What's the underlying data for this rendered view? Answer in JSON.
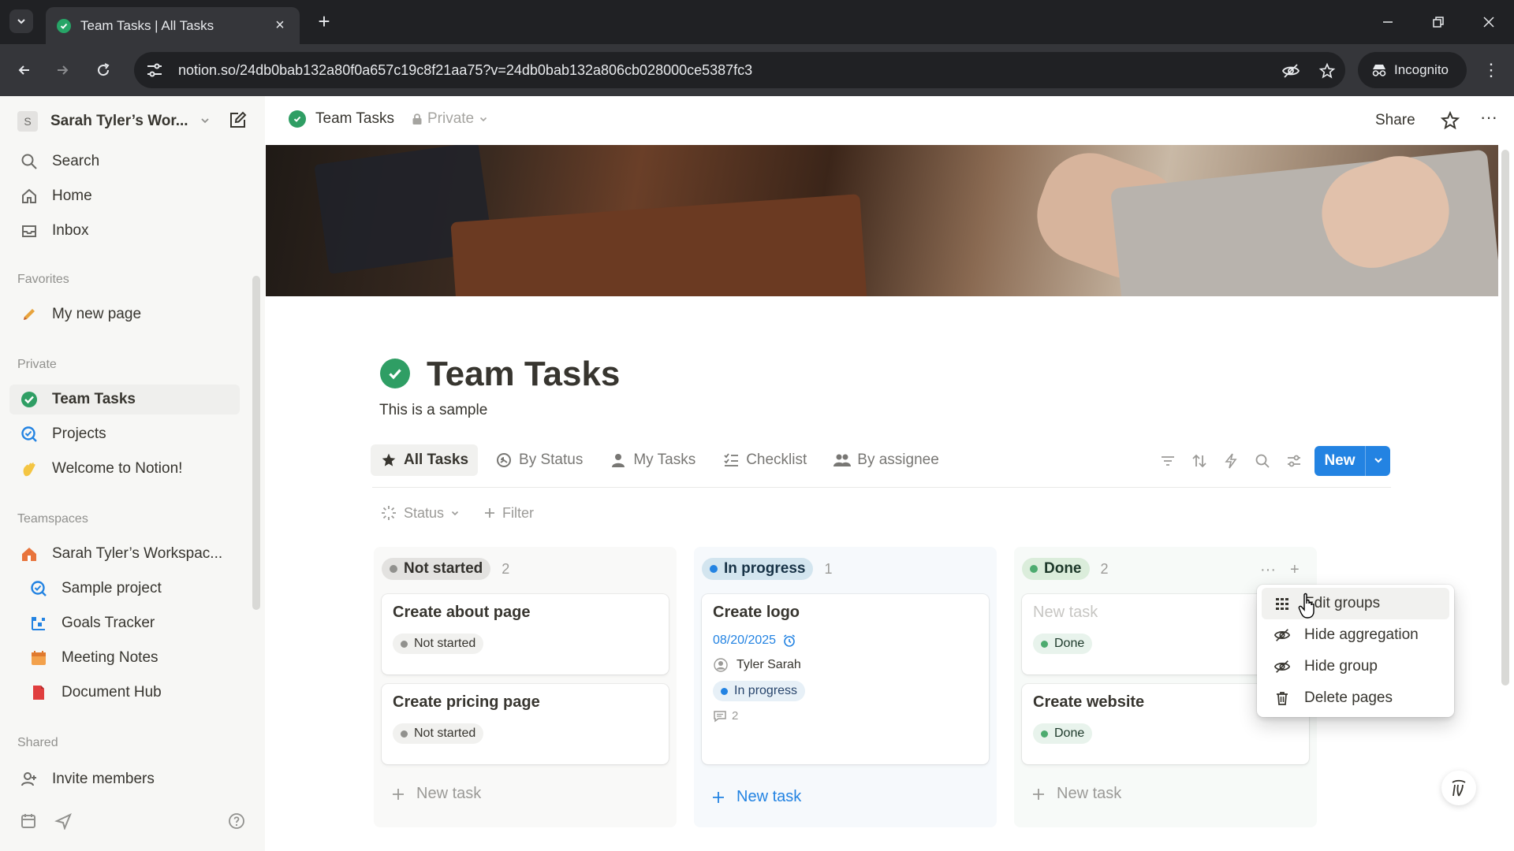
{
  "browser": {
    "tab_title": "Team Tasks | All Tasks",
    "url": "notion.so/24db0bab132a80f0a657c19c8f21aa75?v=24db0bab132a806cb028000ce5387fc3",
    "incognito_label": "Incognito"
  },
  "sidebar": {
    "workspace_name": "Sarah Tyler’s Wor...",
    "workspace_initial": "S",
    "top_items": [
      {
        "label": "Search",
        "icon": "search-icon"
      },
      {
        "label": "Home",
        "icon": "home-icon"
      },
      {
        "label": "Inbox",
        "icon": "inbox-icon"
      }
    ],
    "favorites_label": "Favorites",
    "favorites": [
      {
        "label": "My new page",
        "icon": "pencil-icon"
      }
    ],
    "private_label": "Private",
    "private_items": [
      {
        "label": "Team Tasks",
        "icon": "check-circle-icon"
      },
      {
        "label": "Projects",
        "icon": "projects-icon"
      },
      {
        "label": "Welcome to Notion!",
        "icon": "wave-icon"
      }
    ],
    "teamspaces_label": "Teamspaces",
    "teamspaces": [
      {
        "label": "Sarah Tyler’s Workspac...",
        "icon": "home-icon"
      },
      {
        "label": "Sample project",
        "icon": "project-icon"
      },
      {
        "label": "Goals Tracker",
        "icon": "chart-icon"
      },
      {
        "label": "Meeting Notes",
        "icon": "calendar-icon"
      },
      {
        "label": "Document Hub",
        "icon": "document-icon"
      }
    ],
    "shared_label": "Shared",
    "invite_label": "Invite members"
  },
  "topbar": {
    "breadcrumb": "Team Tasks",
    "privacy": "Private",
    "share_label": "Share"
  },
  "page": {
    "title": "Team Tasks",
    "description": "This is a sample"
  },
  "views": [
    {
      "label": "All Tasks",
      "icon": "star-icon",
      "active": true
    },
    {
      "label": "By Status",
      "icon": "status-icon",
      "active": false
    },
    {
      "label": "My Tasks",
      "icon": "person-icon",
      "active": false
    },
    {
      "label": "Checklist",
      "icon": "checklist-icon",
      "active": false
    },
    {
      "label": "By assignee",
      "icon": "people-icon",
      "active": false
    }
  ],
  "new_button_label": "New",
  "filters": {
    "status_label": "Status",
    "filter_label": "Filter"
  },
  "board": {
    "columns": [
      {
        "status": "Not started",
        "count": "2",
        "cards": [
          {
            "title": "Create about page",
            "status": "Not started"
          },
          {
            "title": "Create pricing page",
            "status": "Not started"
          }
        ],
        "new_task_label": "New task"
      },
      {
        "status": "In progress",
        "count": "1",
        "cards": [
          {
            "title": "Create logo",
            "date": "08/20/2025",
            "assignee": "Tyler Sarah",
            "status": "In progress",
            "comments": "2"
          }
        ],
        "new_task_label": "New task"
      },
      {
        "status": "Done",
        "count": "2",
        "cards": [
          {
            "title": "New task",
            "status": "Done"
          },
          {
            "title": "Create website",
            "status": "Done"
          }
        ],
        "new_task_label": "New task"
      }
    ]
  },
  "context_menu": {
    "items": [
      {
        "label": "Edit groups",
        "icon": "grid-icon"
      },
      {
        "label": "Hide aggregation",
        "icon": "eye-off-icon"
      },
      {
        "label": "Hide group",
        "icon": "eye-off-icon"
      },
      {
        "label": "Delete pages",
        "icon": "trash-icon"
      }
    ]
  },
  "colors": {
    "accent": "#2383e2",
    "done_green": "#4dab6f",
    "not_started_gray": "#91918e"
  }
}
